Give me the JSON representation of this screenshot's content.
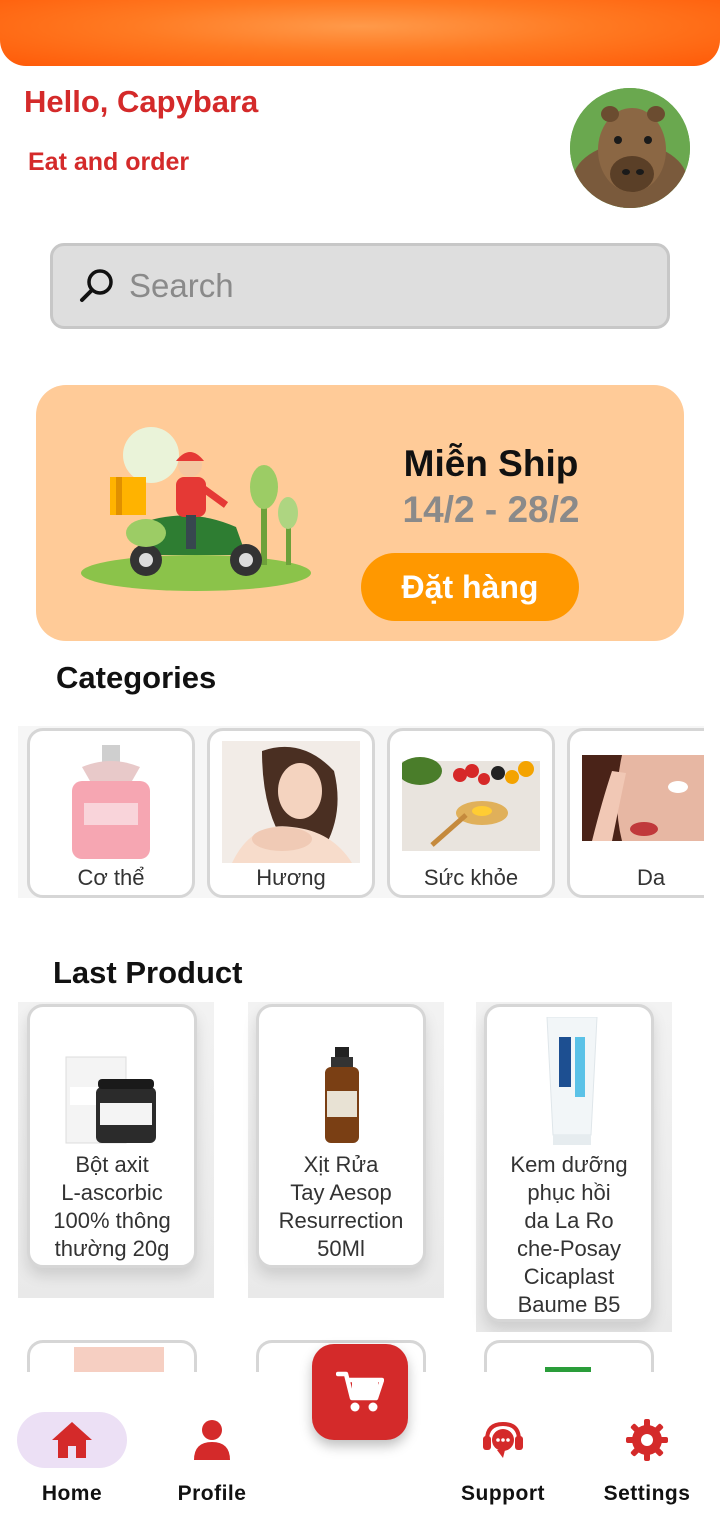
{
  "header": {
    "greeting": "Hello, Capybara",
    "tagline": "Eat and order"
  },
  "search": {
    "placeholder": "Search"
  },
  "promo": {
    "title": "Miễn Ship",
    "dates": "14/2 - 28/2",
    "cta": "Đặt hàng"
  },
  "categories": {
    "title": "Categories",
    "items": [
      {
        "label": "Cơ thể",
        "icon": "perfume-bottle-image"
      },
      {
        "label": "Hương",
        "icon": "woman-skincare-image"
      },
      {
        "label": "Sức khỏe",
        "icon": "healthy-food-image"
      },
      {
        "label": "Da",
        "icon": "face-care-image"
      }
    ]
  },
  "last_product": {
    "title": "Last Product",
    "items": [
      {
        "name": "Bột axit L-ascorbic 100% thông thường 20g",
        "lines": [
          "Bột axit",
          "L-ascorbic",
          "100% thông",
          "thường 20g"
        ]
      },
      {
        "name": "Xịt Rửa Tay Aesop Resurrection 50Ml",
        "lines": [
          "Xịt Rửa",
          "Tay Aesop",
          "Resurrection",
          "50Ml"
        ]
      },
      {
        "name": "Kem dưỡng phục hồi da La Roche-Posay Cicaplast Baume B5",
        "lines": [
          "Kem dưỡng",
          "phục hồi",
          "da La Ro",
          "che-Posay",
          "Cicaplast",
          "Baume B5"
        ]
      }
    ]
  },
  "nav": {
    "items": [
      {
        "label": "Home",
        "icon": "home-icon",
        "active": true
      },
      {
        "label": "Profile",
        "icon": "profile-icon"
      },
      {
        "label": "Support",
        "icon": "support-icon"
      },
      {
        "label": "Settings",
        "icon": "settings-icon"
      }
    ],
    "cart_icon": "cart-icon"
  },
  "colors": {
    "brand_red": "#d42a2a",
    "orange": "#ff9800",
    "banner_bg": "#ffcb98",
    "nav_active_pill": "#ece0f5"
  }
}
